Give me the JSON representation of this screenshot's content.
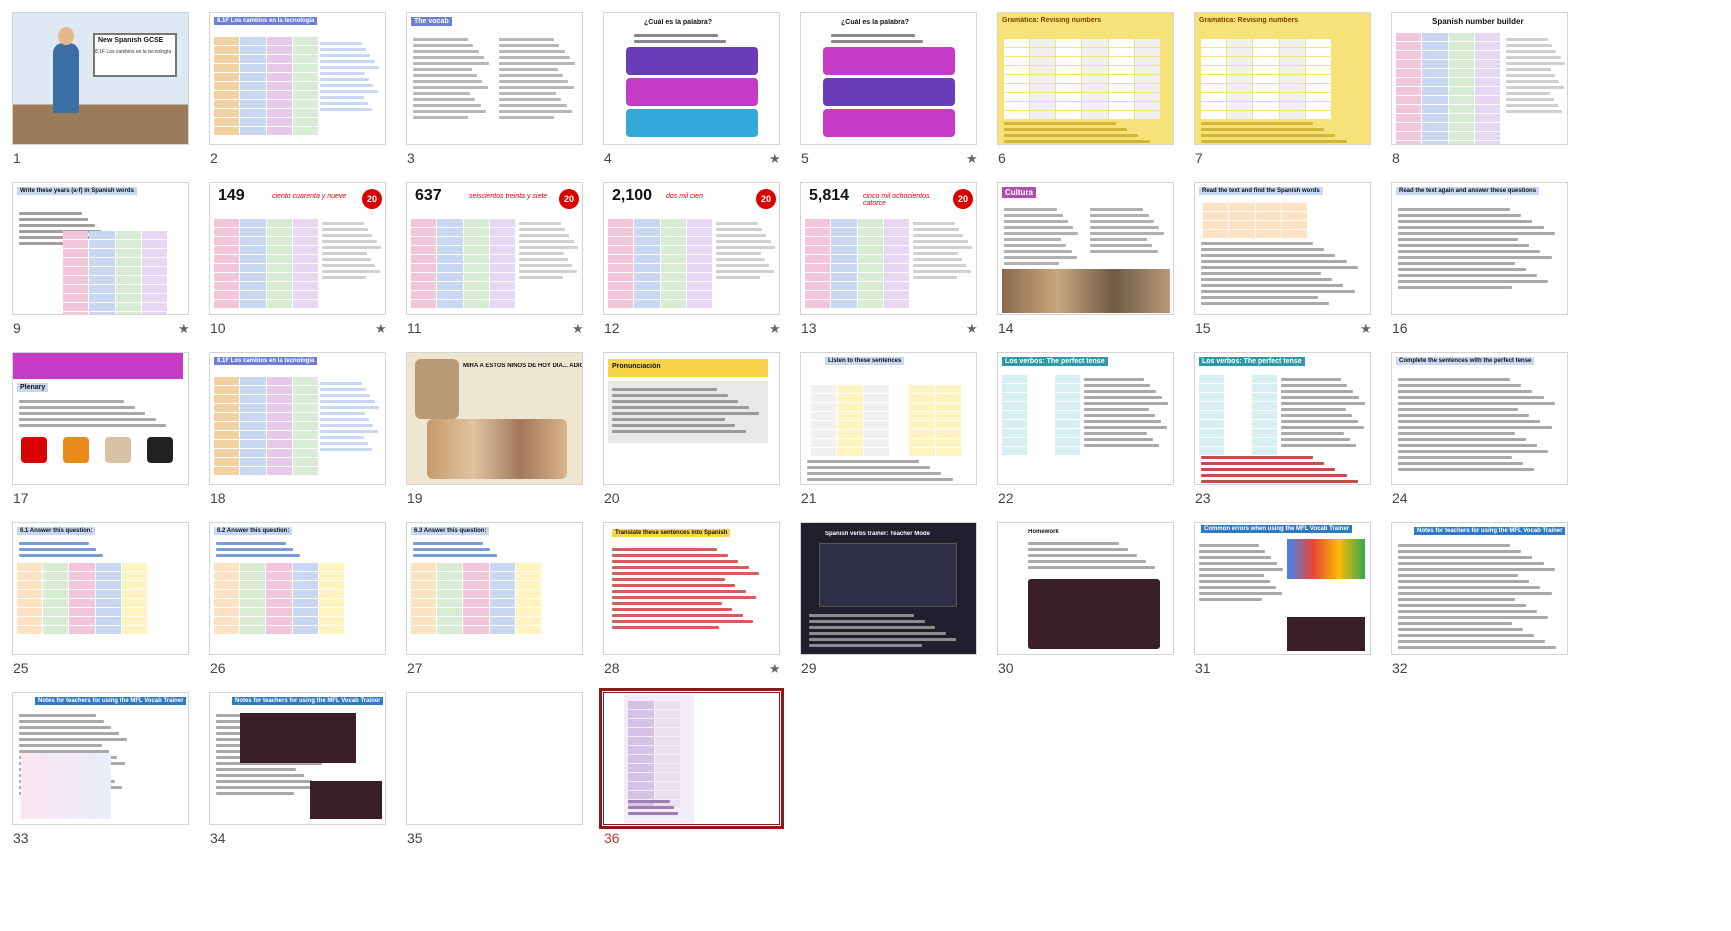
{
  "slides": [
    {
      "n": "1",
      "star": false,
      "title": "New Spanish GCSE",
      "sub": "8.1F Los cambios en la tecnología",
      "kind": "cover"
    },
    {
      "n": "2",
      "star": false,
      "title": "8.1F Los cambios en la tecnología",
      "kind": "table",
      "accent": "#6b7fd7"
    },
    {
      "n": "3",
      "star": false,
      "title": "The vocab",
      "kind": "vocab",
      "accent": "#6b7fd7"
    },
    {
      "n": "4",
      "star": true,
      "title": "¿Cuál es la palabra?",
      "kind": "rebus"
    },
    {
      "n": "5",
      "star": true,
      "title": "¿Cuál es la palabra?",
      "kind": "rebus2"
    },
    {
      "n": "6",
      "star": false,
      "title": "Gramática: Revising numbers",
      "kind": "yellow"
    },
    {
      "n": "7",
      "star": false,
      "title": "Gramática: Revising numbers",
      "kind": "yellow2"
    },
    {
      "n": "8",
      "star": false,
      "title": "Spanish number builder",
      "kind": "builder"
    },
    {
      "n": "9",
      "star": true,
      "title": "Write these years (a-f) in Spanish words",
      "kind": "years"
    },
    {
      "n": "10",
      "star": true,
      "big": "149",
      "red": "ciento cuarenta y nueve",
      "badge": "20",
      "kind": "number"
    },
    {
      "n": "11",
      "star": true,
      "big": "637",
      "red": "seiscientos treinta y siete",
      "badge": "20",
      "kind": "number"
    },
    {
      "n": "12",
      "star": true,
      "big": "2,100",
      "red": "dos mil cien",
      "badge": "20",
      "kind": "number"
    },
    {
      "n": "13",
      "star": true,
      "big": "5,814",
      "red": "cinco mil ochocientos catorce",
      "badge": "20",
      "kind": "number"
    },
    {
      "n": "14",
      "star": false,
      "title": "Cultura",
      "kind": "cultura"
    },
    {
      "n": "15",
      "star": true,
      "title": "Read the text and find the Spanish words",
      "kind": "text"
    },
    {
      "n": "16",
      "star": false,
      "title": "Read the text again and answer these questions",
      "kind": "text2"
    },
    {
      "n": "17",
      "star": false,
      "title": "Plenary",
      "kind": "plenary"
    },
    {
      "n": "18",
      "star": false,
      "title": "8.1F Los cambios en la tecnología",
      "kind": "reading"
    },
    {
      "n": "19",
      "star": false,
      "title": "MIRA A ESTOS NIÑOS DE HOY DÍA... ADICTOS A LA TECNOLOGÍA",
      "kind": "cartoon"
    },
    {
      "n": "20",
      "star": false,
      "title": "Pronunciación",
      "kind": "pron"
    },
    {
      "n": "21",
      "star": false,
      "title": "Listen to these sentences",
      "kind": "listen"
    },
    {
      "n": "22",
      "star": false,
      "title": "Los verbos: The perfect tense",
      "kind": "verbs"
    },
    {
      "n": "23",
      "star": false,
      "title": "Los verbos: The perfect tense",
      "kind": "verbs2"
    },
    {
      "n": "24",
      "star": false,
      "title": "Complete the sentences with the perfect tense",
      "kind": "complete"
    },
    {
      "n": "25",
      "star": false,
      "title": "6.1 Answer this question:",
      "kind": "answer"
    },
    {
      "n": "26",
      "star": false,
      "title": "6.2 Answer this question:",
      "kind": "answer"
    },
    {
      "n": "27",
      "star": false,
      "title": "6.3 Answer this question:",
      "kind": "answer"
    },
    {
      "n": "28",
      "star": true,
      "title": "Translate these sentences into Spanish",
      "kind": "translate"
    },
    {
      "n": "29",
      "star": false,
      "title": "Spanish verbs trainer: Teacher Mode",
      "kind": "trainer"
    },
    {
      "n": "30",
      "star": false,
      "title": "Homework",
      "kind": "homework"
    },
    {
      "n": "31",
      "star": false,
      "title": "Common errors when using the MFL Vocab Trainer",
      "kind": "errors"
    },
    {
      "n": "32",
      "star": false,
      "title": "Notes for teachers for using the MFL Vocab Trainer",
      "kind": "notes"
    },
    {
      "n": "33",
      "star": false,
      "title": "Notes for teachers for using the MFL Vocab Trainer",
      "kind": "notes2"
    },
    {
      "n": "34",
      "star": false,
      "title": "Notes for teachers for using the MFL Vocab Trainer",
      "kind": "notes3"
    },
    {
      "n": "35",
      "star": false,
      "title": "",
      "kind": "blank"
    },
    {
      "n": "36",
      "star": false,
      "title": "",
      "kind": "mini",
      "selected": true
    }
  ],
  "colors": {
    "selected": "#8b1a1a",
    "badge": "#d80000",
    "yellow": "#f7e27a",
    "purple": "#b04fb0",
    "lightblue": "#c9d8f2"
  }
}
